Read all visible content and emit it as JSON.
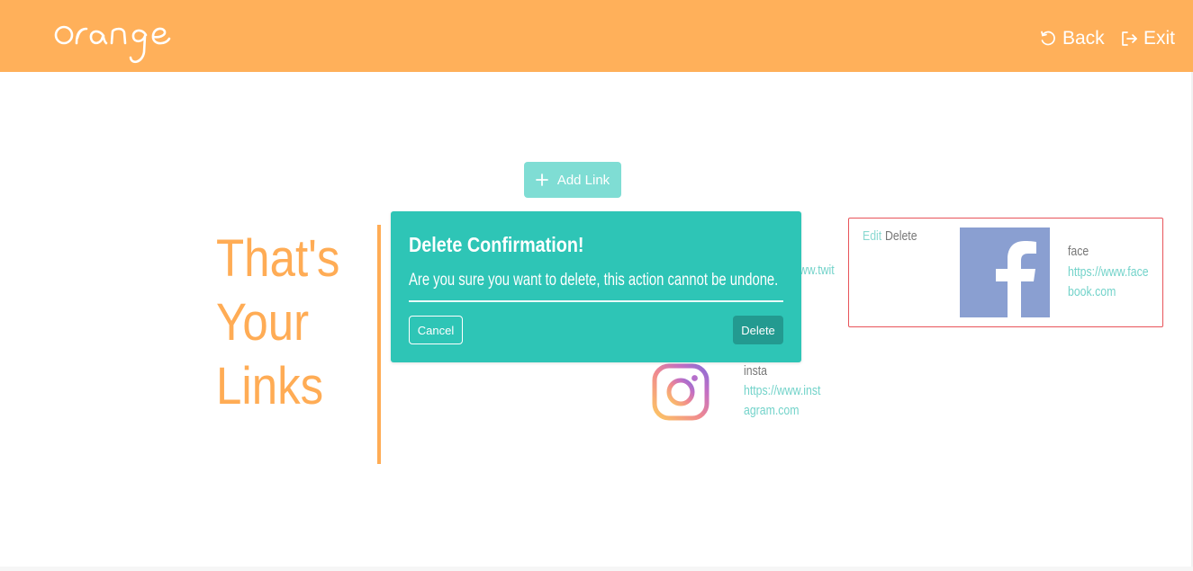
{
  "header": {
    "logo_alt": "orange",
    "back_label": "Back",
    "exit_label": "Exit",
    "back_icon": "undo-icon",
    "exit_icon": "exit-icon",
    "bg_color": "#ffb05a"
  },
  "main": {
    "add_link_label": "Add Link",
    "add_link_icon": "plus-icon",
    "heading_line1": "That's",
    "heading_line2": "Your",
    "heading_line3": "Links",
    "accent_color": "#ffac55"
  },
  "links": [
    {
      "name": "",
      "url_partial": "//www.twit",
      "icon": "twitter-icon"
    },
    {
      "name": "insta",
      "url": "https://www.instagram.com",
      "icon": "instagram-icon"
    },
    {
      "name": "face",
      "url": "https://www.facebook.com",
      "icon": "facebook-icon",
      "edit_label": "Edit",
      "delete_label": "Delete",
      "selected": true
    }
  ],
  "modal": {
    "title": "Delete Confirmation!",
    "message": "Are you sure you want to delete, this action cannot be undone.",
    "cancel_label": "Cancel",
    "delete_label": "Delete",
    "bg_color": "#2ec5b6"
  }
}
